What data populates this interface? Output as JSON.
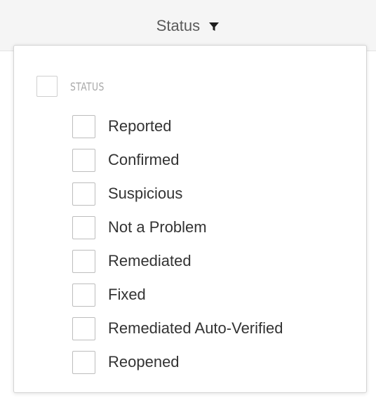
{
  "header": {
    "title": "Status",
    "icon": "filter-icon"
  },
  "filter_popover": {
    "group": {
      "label": "STATUS",
      "checked": false
    },
    "options": [
      {
        "label": "Reported",
        "checked": false
      },
      {
        "label": "Confirmed",
        "checked": false
      },
      {
        "label": "Suspicious",
        "checked": false
      },
      {
        "label": "Not a Problem",
        "checked": false
      },
      {
        "label": "Remediated",
        "checked": false
      },
      {
        "label": "Fixed",
        "checked": false
      },
      {
        "label": "Remediated Auto-Verified",
        "checked": false
      },
      {
        "label": "Reopened",
        "checked": false
      }
    ]
  }
}
